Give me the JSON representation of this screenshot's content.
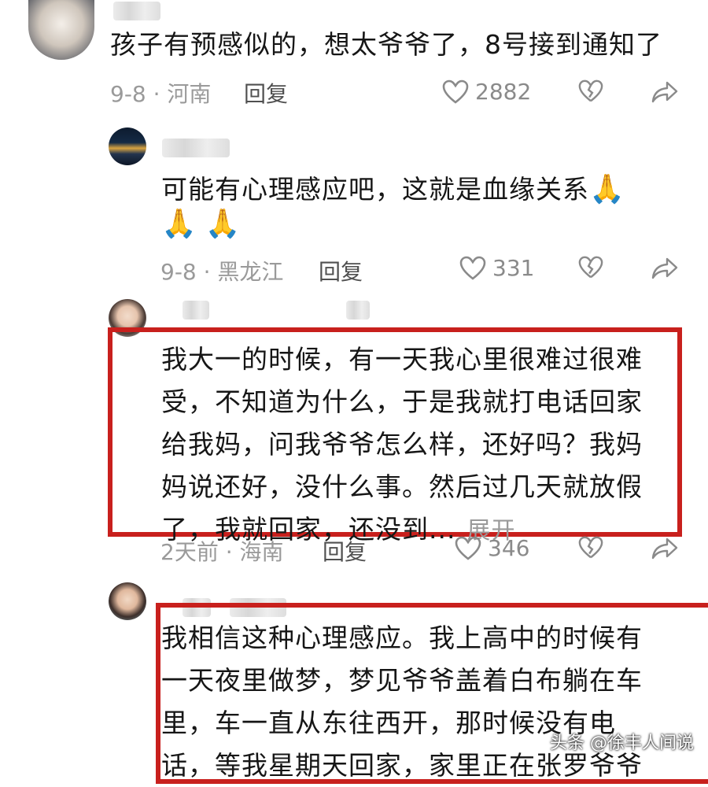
{
  "comments": [
    {
      "text": "孩子有预感似的，想太爷爷了，8号接到通知了",
      "date_location": "9-8 · 河南",
      "reply_label": "回复",
      "likes": "2882"
    },
    {
      "text_line1": "可能有心理感应吧，这就是血缘关系",
      "emoji": "🙏",
      "date_location": "9-8 · 黑龙江",
      "reply_label": "回复",
      "likes": "331"
    },
    {
      "lines": [
        "我大一的时候，有一天我心里很难过很难",
        "受，不知道为什么，于是我就打电话回家",
        "给我妈，问我爷爷怎么样，还好吗？我妈",
        "妈说还好，没什么事。然后过几天就放假",
        "了，我就回家，还没到..."
      ],
      "expand_label": "展开",
      "date_location": "2天前 · 海南",
      "reply_label": "回复",
      "likes": "346"
    },
    {
      "lines": [
        "我相信这种心理感应。我上高中的时候有",
        "一天夜里做梦，梦见爷爷盖着白布躺在车",
        "里，车一直从东往西开，那时候没有电",
        "话，等我星期天回家，家里正在张罗爷爷"
      ]
    }
  ],
  "icons": {
    "like": "heart-outline-icon",
    "dislike": "broken-heart-icon",
    "share": "share-arrow-icon"
  },
  "colors": {
    "highlight_box": "#c8201d"
  },
  "watermark": "头条 @徐丰人间说"
}
